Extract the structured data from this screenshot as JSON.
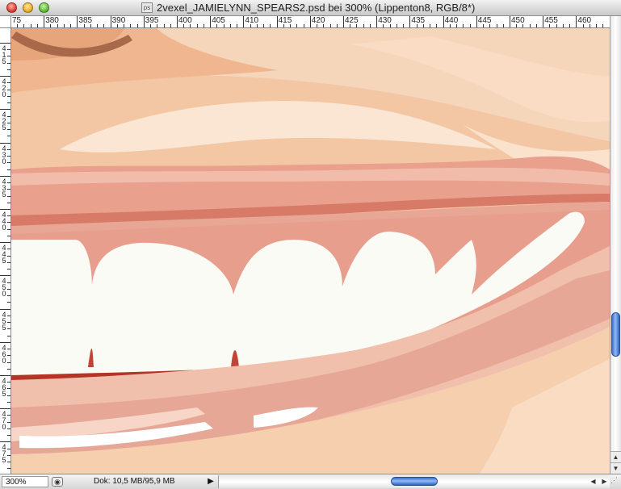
{
  "window": {
    "title": "2vexel_JAMIELYNN_SPEARS2.psd bei 300% (Lippenton8, RGB/8*)",
    "doc_icon": "ps"
  },
  "rulers": {
    "horizontal": [
      "75",
      "380",
      "385",
      "390",
      "395",
      "400",
      "405",
      "410",
      "415",
      "420",
      "425",
      "430",
      "435",
      "440",
      "445",
      "450",
      "455",
      "460"
    ],
    "vertical": [
      "415",
      "420",
      "425",
      "430",
      "435",
      "440",
      "445",
      "450",
      "455",
      "460",
      "465",
      "470",
      "475"
    ]
  },
  "status": {
    "zoom": "300%",
    "doc_info": "Dok: 10,5 MB/95,9 MB",
    "menu_arrow": "▶"
  },
  "colors": {
    "skin_light": "#f6d2b4",
    "skin_mid": "#efb68f",
    "lip": "#e69a86",
    "gum": "#d47262",
    "teeth": "#fbfbf6",
    "scroll_accent": "#5b8de0"
  },
  "icons": {
    "close": "close-icon",
    "minimize": "minimize-icon",
    "zoom": "zoom-icon",
    "status_menu": "status-menu-icon"
  }
}
